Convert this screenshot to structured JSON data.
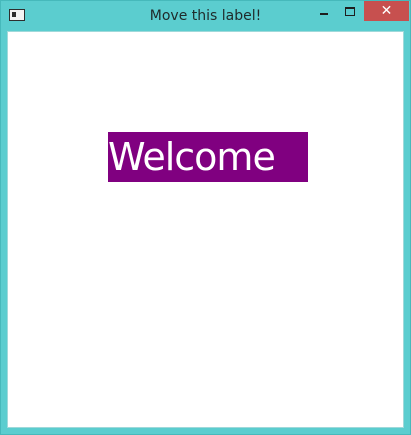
{
  "window": {
    "title": "Move this label!",
    "close_glyph": "✕",
    "icons": {
      "app": "window-app-icon",
      "minimize": "minimize-icon",
      "maximize": "maximize-icon",
      "close": "close-icon"
    },
    "colors": {
      "titlebar": "#5bcdcf",
      "close_button": "#c7504f",
      "client": "#ffffff"
    }
  },
  "content": {
    "label_text": "Welcome",
    "label_colors": {
      "background": "#800080",
      "text": "#ffffff"
    }
  }
}
